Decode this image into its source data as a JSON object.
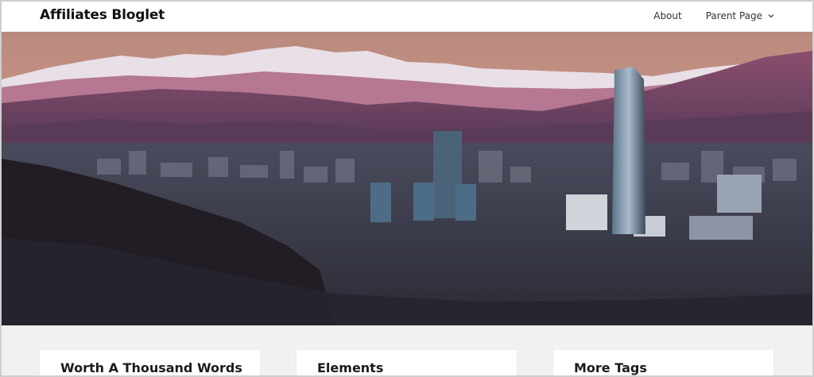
{
  "header": {
    "site_title": "Affiliates Bloglet",
    "nav": [
      {
        "label": "About"
      },
      {
        "label": "Parent Page"
      }
    ]
  },
  "hero": {
    "image": "city-skyline-with-mountains"
  },
  "cards": [
    {
      "title": "Worth A Thousand Words"
    },
    {
      "title": "Elements"
    },
    {
      "title": "More Tags"
    }
  ],
  "colors": {
    "header_bg": "#ffffff",
    "page_bg": "#f1f1f1",
    "title_text": "#111111"
  }
}
